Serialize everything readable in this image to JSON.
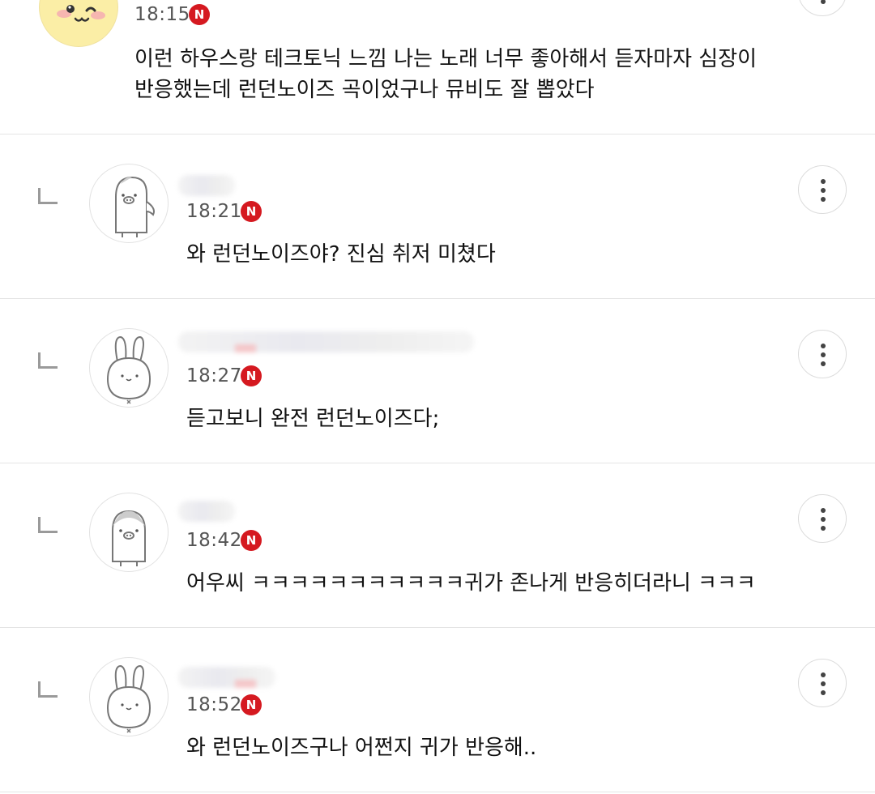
{
  "comments": [
    {
      "time": "18:15",
      "badge": "N",
      "text_line1": "이런 하우스랑 테크토닉 느낌 나는 노래 너무 좋아해서 듣자마자 심장이",
      "text_line2": "반응했는데 런던노이즈 곡이었구나 뮤비도 잘 뽑았다",
      "avatar": "yellow-smile-avatar"
    },
    {
      "time": "18:21",
      "badge": "N",
      "text": "와 런던노이즈야? 진심 취저 미쳤다",
      "avatar": "penguin-avatar"
    },
    {
      "time": "18:27",
      "badge": "N",
      "text": "듣고보니 완전 런던노이즈다;",
      "avatar": "bunny-avatar"
    },
    {
      "time": "18:42",
      "badge": "N",
      "text": "어우씨 ㅋㅋㅋㅋㅋㅋㅋㅋㅋㅋㅋ귀가 존나게 반응히더라니 ㅋㅋㅋ",
      "avatar": "penguin-avatar"
    },
    {
      "time": "18:52",
      "badge": "N",
      "text": "와 런던노이즈구나 어쩐지 귀가 반응해..",
      "avatar": "bunny-avatar"
    }
  ],
  "colors": {
    "badge": "#d51920",
    "divider": "#e4e4e4",
    "time": "#555555",
    "avatar_yellow": "#fbeea6"
  },
  "icons": {
    "more": "more-vertical-icon",
    "reply": "reply-arrow-icon",
    "badge": "naver-badge-icon"
  }
}
